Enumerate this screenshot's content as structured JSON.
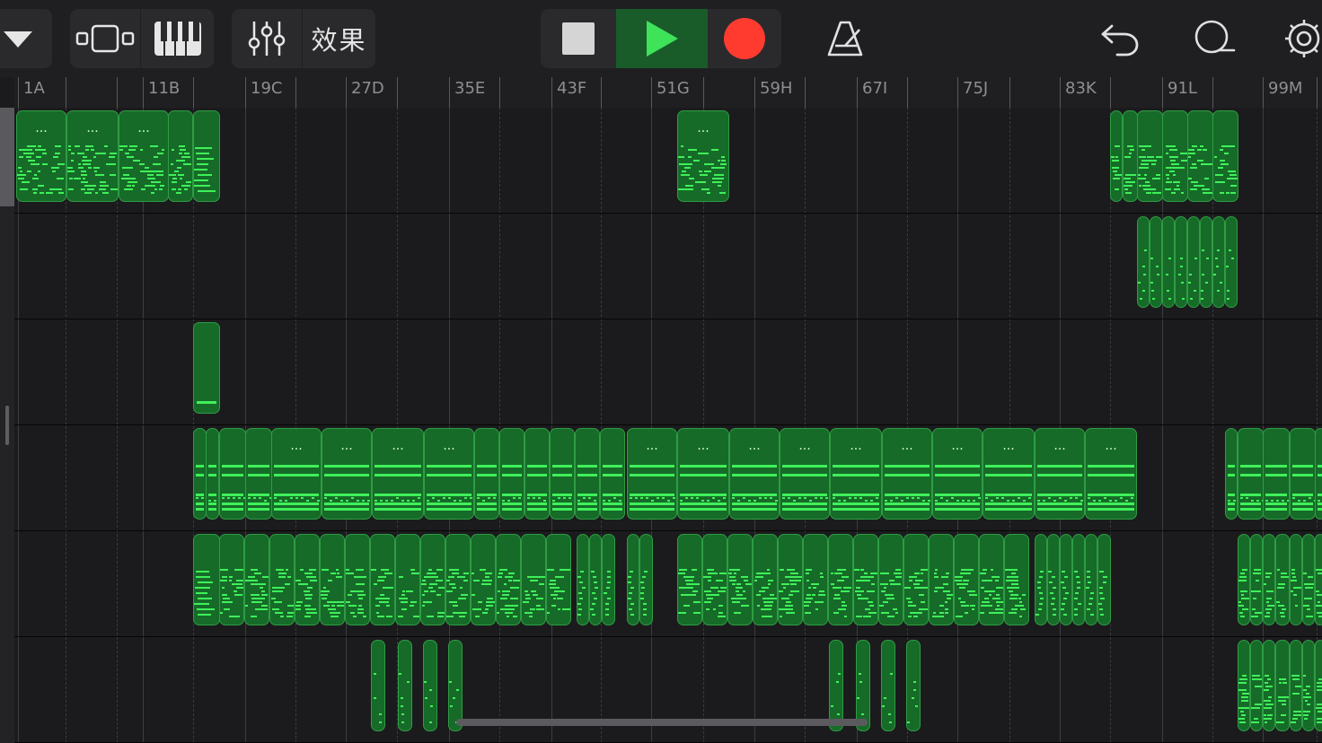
{
  "toolbar": {
    "effects_label": "效果",
    "accent_green": "#2b8a3e",
    "record_red": "#ff3b30",
    "buttons": [
      "track-menu",
      "tracks-view",
      "keyboard",
      "mixer",
      "effects",
      "stop",
      "play",
      "record",
      "metronome",
      "undo",
      "loop-browser",
      "settings"
    ]
  },
  "ruler": {
    "bar_labels": [
      "1A",
      "11B",
      "19C",
      "27D",
      "35E",
      "43F",
      "51G",
      "59H",
      "67I",
      "75J",
      "83K",
      "91L",
      "99M"
    ]
  },
  "tracks": {
    "count": 6,
    "region_title": "..."
  }
}
